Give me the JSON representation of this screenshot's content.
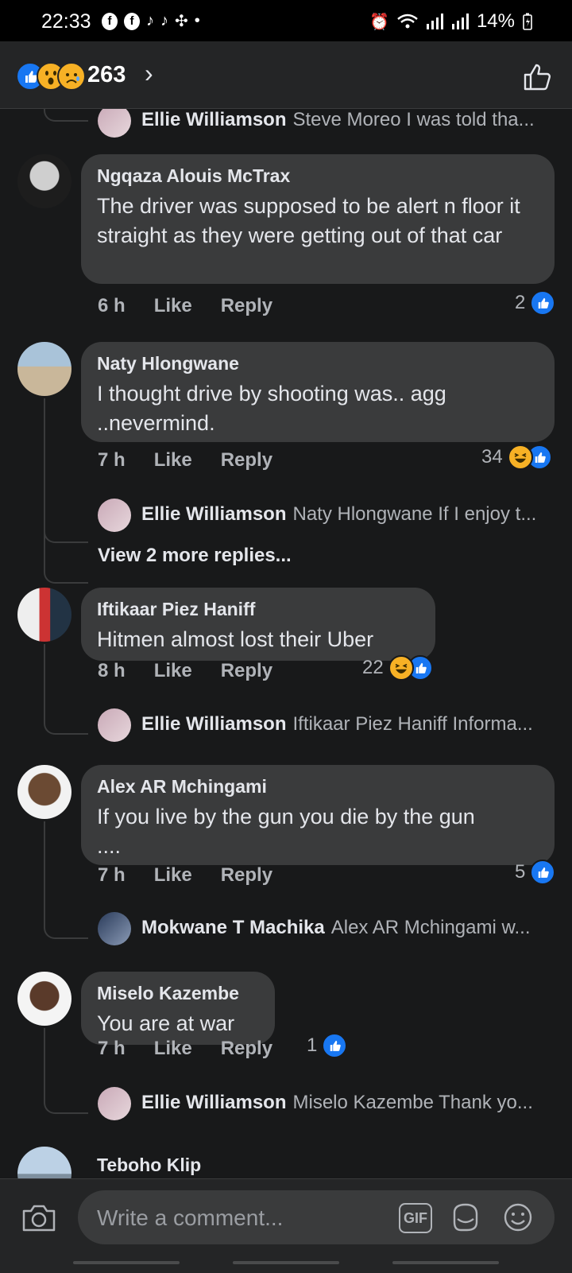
{
  "status_bar": {
    "time": "22:33",
    "battery": "14%"
  },
  "reactions": {
    "count": "263"
  },
  "comments": [
    {
      "reply": {
        "name": "Ellie Williamson",
        "text": "Steve Moreo I was told tha..."
      }
    },
    {
      "name": "Ngqaza Alouis McTrax",
      "text": "The driver was supposed to be alert n floor it straight as they were getting out of that car",
      "time": "6 h",
      "like": "Like",
      "reply_btn": "Reply",
      "reaction_count": "2"
    },
    {
      "name": "Naty Hlongwane",
      "text": "I thought drive by shooting was.. agg ..nevermind.",
      "time": "7 h",
      "like": "Like",
      "reply_btn": "Reply",
      "reaction_count": "34",
      "reply": {
        "name": "Ellie Williamson",
        "text": "Naty Hlongwane If I enjoy t..."
      },
      "more": "View 2 more replies..."
    },
    {
      "name": "Iftikaar Piez Haniff",
      "text": "Hitmen almost lost their Uber",
      "time": "8 h",
      "like": "Like",
      "reply_btn": "Reply",
      "reaction_count": "22",
      "reply": {
        "name": "Ellie Williamson",
        "text": "Iftikaar Piez Haniff Informa..."
      }
    },
    {
      "name": "Alex AR Mchingami",
      "text": "If you live by the gun you die by the gun ....",
      "time": "7 h",
      "like": "Like",
      "reply_btn": "Reply",
      "reaction_count": "5",
      "reply": {
        "name": "Mokwane T Machika",
        "text": "Alex AR Mchingami w..."
      }
    },
    {
      "name": "Miselo Kazembe",
      "text": "You are at war",
      "time": "7 h",
      "like": "Like",
      "reply_btn": "Reply",
      "reaction_count": "1",
      "reply": {
        "name": "Ellie Williamson",
        "text": "Miselo Kazembe Thank yo..."
      }
    },
    {
      "name": "Teboho Klip"
    }
  ],
  "composer": {
    "placeholder": "Write a comment...",
    "gif_label": "GIF"
  },
  "colors": {
    "background": "#18191a",
    "bubble": "#3a3b3c",
    "like_blue": "#1877f2",
    "haha_yellow": "#f7b125"
  },
  "icons": [
    "facebook-icon",
    "tiktok-icon",
    "pinwheel-icon",
    "alarm-icon",
    "wifi-icon",
    "signal-icon",
    "battery-icon",
    "like-reaction-icon",
    "wow-reaction-icon",
    "sad-reaction-icon",
    "chevron-right-icon",
    "thumbs-up-outline-icon",
    "camera-icon",
    "gif-icon",
    "sticker-icon",
    "emoji-icon"
  ]
}
